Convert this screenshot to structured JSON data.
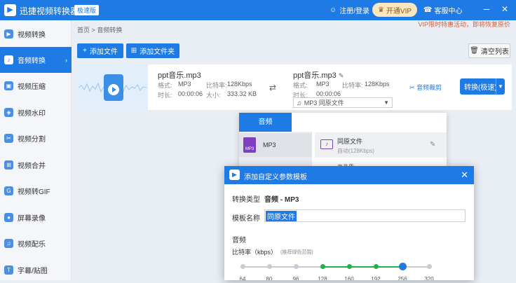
{
  "titlebar": {
    "app_title": "迅捷视频转换器",
    "edition": "极速版",
    "user_label": "注册/登录",
    "vip_label": "开通VIP",
    "service_label": "客服中心",
    "icons": [
      "user-icon",
      "crown-icon",
      "headset-icon",
      "minimize-icon",
      "close-icon"
    ]
  },
  "sidebar": {
    "items": [
      {
        "label": "视频转换",
        "icon": "video-convert-icon",
        "active": false
      },
      {
        "label": "音频转换",
        "icon": "audio-convert-icon",
        "active": true
      },
      {
        "label": "视频压缩",
        "icon": "video-compress-icon",
        "active": false
      },
      {
        "label": "视频水印",
        "icon": "video-watermark-icon",
        "active": false
      },
      {
        "label": "视频分割",
        "icon": "video-split-icon",
        "active": false
      },
      {
        "label": "视频合并",
        "icon": "video-merge-icon",
        "active": false
      },
      {
        "label": "视频转GIF",
        "icon": "video-gif-icon",
        "active": false
      },
      {
        "label": "屏幕录像",
        "icon": "screen-record-icon",
        "active": false
      },
      {
        "label": "视频配乐",
        "icon": "video-music-icon",
        "active": false
      },
      {
        "label": "字幕/贴图",
        "icon": "subtitle-icon",
        "active": false
      }
    ]
  },
  "breadcrumb": {
    "home": "首页",
    "separator": ">",
    "current": "音频转换"
  },
  "notice": "VIP限时特惠活动，即将恢复原价",
  "toolbar": {
    "add_file": "添加文件",
    "add_folder": "添加文件夹",
    "clear_list": "清空列表"
  },
  "file": {
    "source_name": "ppt音乐.mp3",
    "source_format_label": "格式:",
    "source_format": "MP3",
    "source_bitrate_label": "比特率:",
    "source_bitrate": "128Kbps",
    "source_duration_label": "时长:",
    "source_duration": "00:00:06",
    "source_size_label": "大小:",
    "source_size": "333.32 KB",
    "target_name": "ppt音乐.mp3",
    "target_format_label": "格式:",
    "target_format": "MP3",
    "target_bitrate_label": "比特率:",
    "target_bitrate": "128Kbps",
    "target_duration_label": "时长:",
    "target_duration": "00:00:06",
    "output_select": "MP3  同原文件",
    "clip_label": "音频裁剪",
    "convert_label": "转换(极速)"
  },
  "format_panel": {
    "tab": "音频",
    "format_item": "MP3",
    "preset_name": "同原文件",
    "preset_sub": "自动(128Kbps)",
    "preset_cut": "高品质"
  },
  "dialog": {
    "title": "添加自定义参数模板",
    "type_label": "转换类型",
    "type_value": "音频 - MP3",
    "name_label": "模板名称",
    "name_value": "同原文件",
    "section_audio": "音频",
    "bitrate_label": "比特率（kbps）",
    "bitrate_hint": "(推荐绿色范围)",
    "bitrate_ticks": [
      "64",
      "80",
      "96",
      "128",
      "160",
      "192",
      "256",
      "320"
    ],
    "bitrate_selected": "256",
    "bitrate_recommended": [
      "128",
      "160",
      "192",
      "256"
    ]
  },
  "colors": {
    "brand": "#1e7be6",
    "recommended": "#22b04b",
    "notice": "#e05a2b",
    "vip_bg": "#fbe7bf"
  }
}
